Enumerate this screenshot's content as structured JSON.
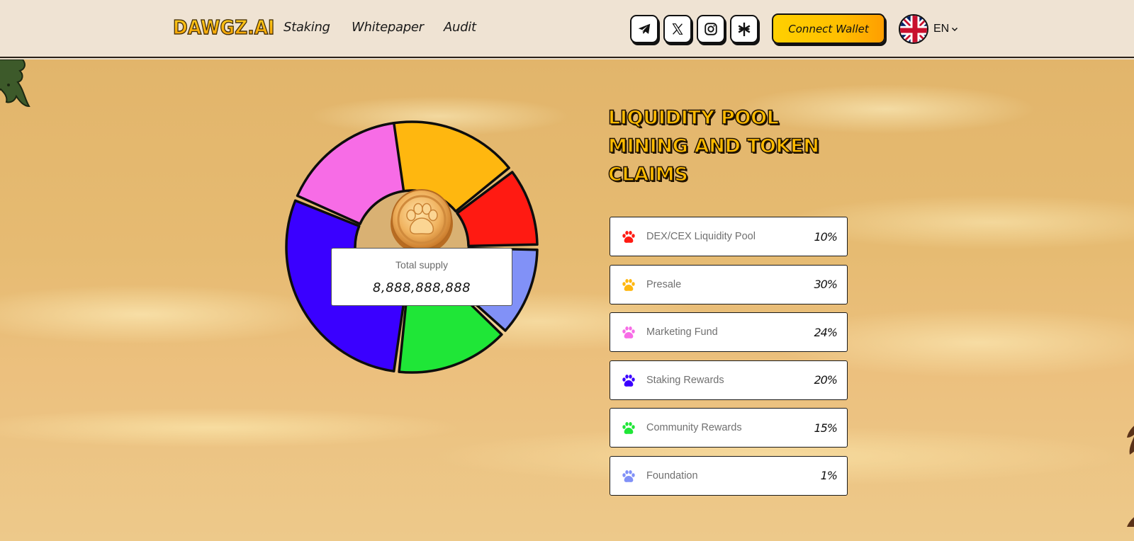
{
  "header": {
    "logo": "DAWGZ.AI",
    "nav": [
      {
        "label": "Staking"
      },
      {
        "label": "Whitepaper"
      },
      {
        "label": "Audit"
      }
    ],
    "social_icons": [
      "telegram-icon",
      "x-icon",
      "instagram-icon",
      "linktree-icon"
    ],
    "connect_wallet_label": "Connect Wallet",
    "language": {
      "label": "EN",
      "flag": "uk-flag-icon"
    }
  },
  "section": {
    "title": "LIQUIDITY POOL MINING AND TOKEN CLAIMS",
    "total_supply_label": "Total supply",
    "total_supply_value": "8,888,888,888"
  },
  "chart_data": {
    "type": "pie",
    "title": "Total supply",
    "center_label": "8,888,888,888",
    "categories": [
      "DEX/CEX Liquidity Pool",
      "Presale",
      "Marketing Fund",
      "Staking Rewards",
      "Community Rewards",
      "Foundation"
    ],
    "values": [
      10,
      30,
      24,
      20,
      15,
      1
    ],
    "unit": "%",
    "colors": [
      "#ff1a12",
      "#ffb70f",
      "#f76ce6",
      "#3a00ff",
      "#1fe637",
      "#8191f7"
    ]
  },
  "allocations": [
    {
      "label": "DEX/CEX Liquidity Pool",
      "percent": "10%",
      "color": "#ff1a12"
    },
    {
      "label": "Presale",
      "percent": "30%",
      "color": "#ffb70f"
    },
    {
      "label": "Marketing Fund",
      "percent": "24%",
      "color": "#f76ce6"
    },
    {
      "label": "Staking Rewards",
      "percent": "20%",
      "color": "#3a00ff"
    },
    {
      "label": "Community Rewards",
      "percent": "15%",
      "color": "#1fe637"
    },
    {
      "label": "Foundation",
      "percent": "1%",
      "color": "#8191f7"
    }
  ]
}
